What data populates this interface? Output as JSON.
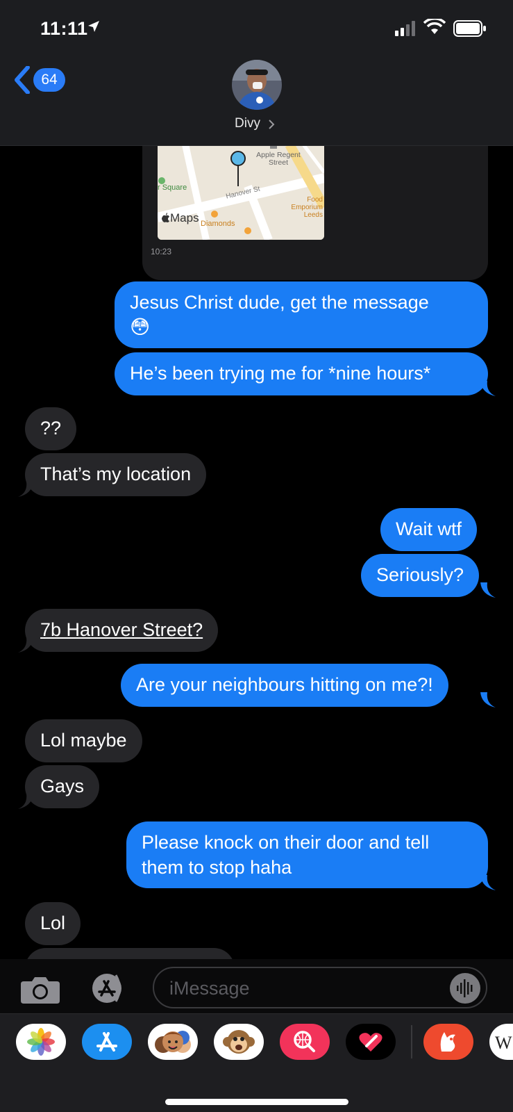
{
  "status": {
    "time": "11:11"
  },
  "nav": {
    "back_count": "64",
    "contact_name": "Divy"
  },
  "location_card": {
    "map_labels": {
      "poi_name": "Apple Regent Street",
      "square": "r Square",
      "street": "Hanover St",
      "food": "Food Emporium Leeds",
      "diamonds": "Diamonds",
      "brand": "Maps"
    },
    "time": "10:23"
  },
  "messages": [
    {
      "dir": "out",
      "lines": [
        "Jesus Christ dude, get the message",
        "😳"
      ]
    },
    {
      "dir": "out",
      "lines": [
        "He’s been trying me for *nine hours*"
      ]
    },
    {
      "dir": "in",
      "lines": [
        "??"
      ]
    },
    {
      "dir": "in",
      "lines": [
        "That’s my location"
      ]
    },
    {
      "dir": "out",
      "lines": [
        "Wait wtf"
      ]
    },
    {
      "dir": "out",
      "lines": [
        "Seriously?"
      ]
    },
    {
      "dir": "in",
      "lines": [
        "7b Hanover Street?"
      ]
    },
    {
      "dir": "out",
      "lines": [
        "Are your neighbours hitting on me?!"
      ]
    },
    {
      "dir": "in",
      "lines": [
        "Lol maybe"
      ]
    },
    {
      "dir": "in",
      "lines": [
        "Gays"
      ]
    },
    {
      "dir": "out",
      "lines": [
        "Please knock on their door and tell",
        "them to stop haha"
      ]
    },
    {
      "dir": "in",
      "lines": [
        "Lol"
      ]
    }
  ],
  "input": {
    "placeholder": "iMessage"
  },
  "apps": [
    {
      "icon": "photos-icon"
    },
    {
      "icon": "app-store-icon"
    },
    {
      "icon": "memoji-icon"
    },
    {
      "icon": "animoji-monkey-icon"
    },
    {
      "icon": "web-search-icon"
    },
    {
      "icon": "digital-touch-icon"
    },
    {
      "icon": "fox-app-icon"
    },
    {
      "icon": "wikipedia-icon"
    }
  ],
  "colors": {
    "outgoing_bubble": "#1a7df5",
    "incoming_bubble": "#262629",
    "badge": "#2a7cf7"
  }
}
